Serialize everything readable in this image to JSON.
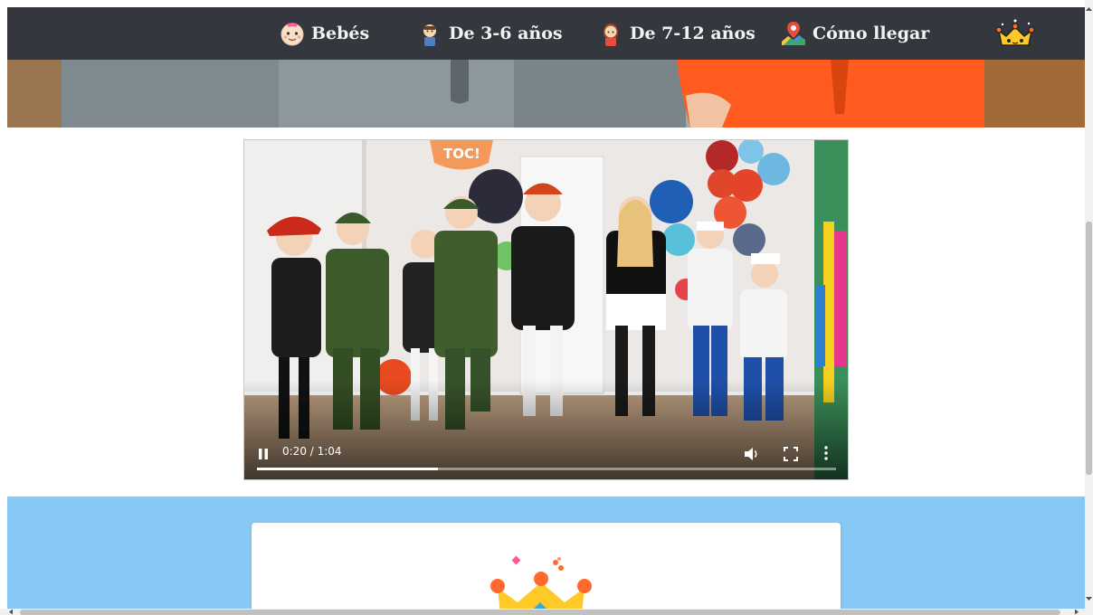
{
  "nav": {
    "items": [
      {
        "label": "Bebés",
        "icon": "baby-face-icon"
      },
      {
        "label": "De 3-6 años",
        "icon": "boy-icon"
      },
      {
        "label": "De 7-12 años",
        "icon": "girl-icon"
      },
      {
        "label": "Cómo llegar",
        "icon": "map-pin-icon"
      }
    ],
    "logo_icon": "crown-icon"
  },
  "video": {
    "time_display": "0:20 / 1:04",
    "progress_fraction": 0.3125,
    "sign_text": "TOC!"
  },
  "colors": {
    "navbar": "#34373d",
    "blue_section": "#86c9f5",
    "crown_yellow": "#ffc928",
    "crown_orange": "#ff6a2a"
  }
}
